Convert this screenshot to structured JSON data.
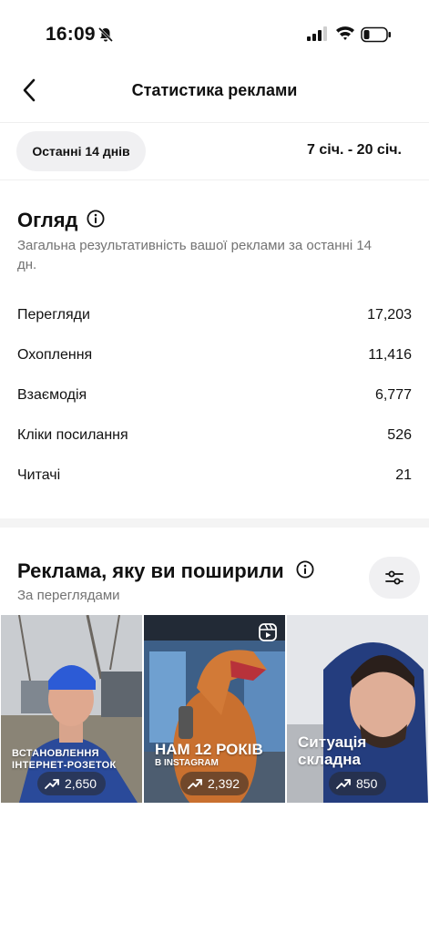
{
  "status_bar": {
    "time": "16:09"
  },
  "nav": {
    "title": "Статистика реклами"
  },
  "date_filter": {
    "chip_label": "Останні 14 днів",
    "range": "7 січ. - 20 січ."
  },
  "overview": {
    "title": "Огляд",
    "subtitle_line1": "Загальна результативність вашої реклами за останні 14",
    "subtitle_line2": "дн.",
    "metrics": [
      {
        "label": "Перегляди",
        "value": "17,203"
      },
      {
        "label": "Охоплення",
        "value": "11,416"
      },
      {
        "label": "Взаємодія",
        "value": "6,777"
      },
      {
        "label": "Кліки посилання",
        "value": "526"
      },
      {
        "label": "Читачі",
        "value": "21"
      }
    ]
  },
  "boosted": {
    "title": "Реклама, яку ви поширили",
    "subtitle": "За переглядами",
    "items": [
      {
        "caption_line1": "встановлення",
        "caption_line2": "інтернет-розеток",
        "views": "2,650"
      },
      {
        "caption_line1": "Нам 12 років",
        "caption_line2": "в Instagram",
        "views": "2,392"
      },
      {
        "caption_line1": "Ситуація",
        "caption_line2": "складна",
        "views": "850"
      }
    ]
  },
  "colors": {
    "chip_bg": "#f0f0f2",
    "muted_text": "#737373",
    "jacket_blue": "#2a4a9a"
  }
}
